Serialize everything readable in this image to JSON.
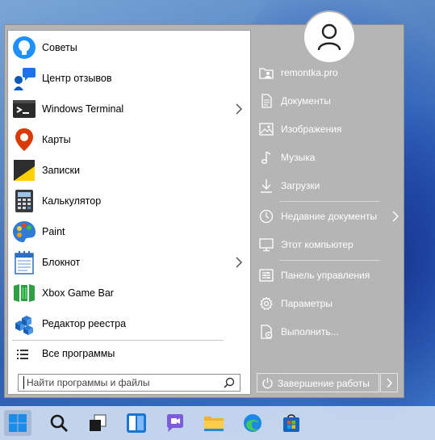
{
  "user": {
    "avatar_icon": "user-silhouette-icon"
  },
  "left_panel": {
    "apps": [
      {
        "label": "Советы",
        "icon": "tips-bulb-icon",
        "has_submenu": false
      },
      {
        "label": "Центр отзывов",
        "icon": "feedback-hub-icon",
        "has_submenu": false
      },
      {
        "label": "Windows Terminal",
        "icon": "terminal-icon",
        "has_submenu": true
      },
      {
        "label": "Карты",
        "icon": "maps-pin-icon",
        "has_submenu": false
      },
      {
        "label": "Записки",
        "icon": "sticky-notes-icon",
        "has_submenu": false
      },
      {
        "label": "Калькулятор",
        "icon": "calculator-icon",
        "has_submenu": false
      },
      {
        "label": "Paint",
        "icon": "paint-palette-icon",
        "has_submenu": false
      },
      {
        "label": "Блокнот",
        "icon": "notepad-icon",
        "has_submenu": true
      },
      {
        "label": "Xbox Game Bar",
        "icon": "xbox-game-bar-icon",
        "has_submenu": false
      },
      {
        "label": "Редактор реестра",
        "icon": "registry-editor-icon",
        "has_submenu": false
      }
    ],
    "all_programs_label": "Все программы",
    "search_placeholder": "Найти программы и файлы"
  },
  "right_panel": {
    "items": [
      {
        "label": "remontka.pro",
        "icon": "user-folder-icon"
      },
      {
        "label": "Документы",
        "icon": "document-icon"
      },
      {
        "label": "Изображения",
        "icon": "image-icon"
      },
      {
        "label": "Музыка",
        "icon": "music-note-icon"
      },
      {
        "label": "Загрузки",
        "icon": "download-arrow-icon"
      },
      {
        "label": "Недавние документы",
        "icon": "clock-icon"
      },
      {
        "label": "Этот компьютер",
        "icon": "monitor-icon"
      },
      {
        "label": "Панель управления",
        "icon": "control-panel-icon"
      },
      {
        "label": "Параметры",
        "icon": "gear-icon"
      },
      {
        "label": "Выполнить...",
        "icon": "run-icon"
      }
    ],
    "shutdown_label": "Завершение работы"
  },
  "taskbar": {
    "items": [
      "windows-start-icon",
      "search-icon",
      "task-view-icon",
      "widgets-icon",
      "chat-icon",
      "file-explorer-icon",
      "edge-browser-icon",
      "store-icon"
    ]
  },
  "colors": {
    "menu_bg": "#b5b5b5",
    "left_panel_bg": "#ffffff",
    "right_text": "#ffffff"
  }
}
